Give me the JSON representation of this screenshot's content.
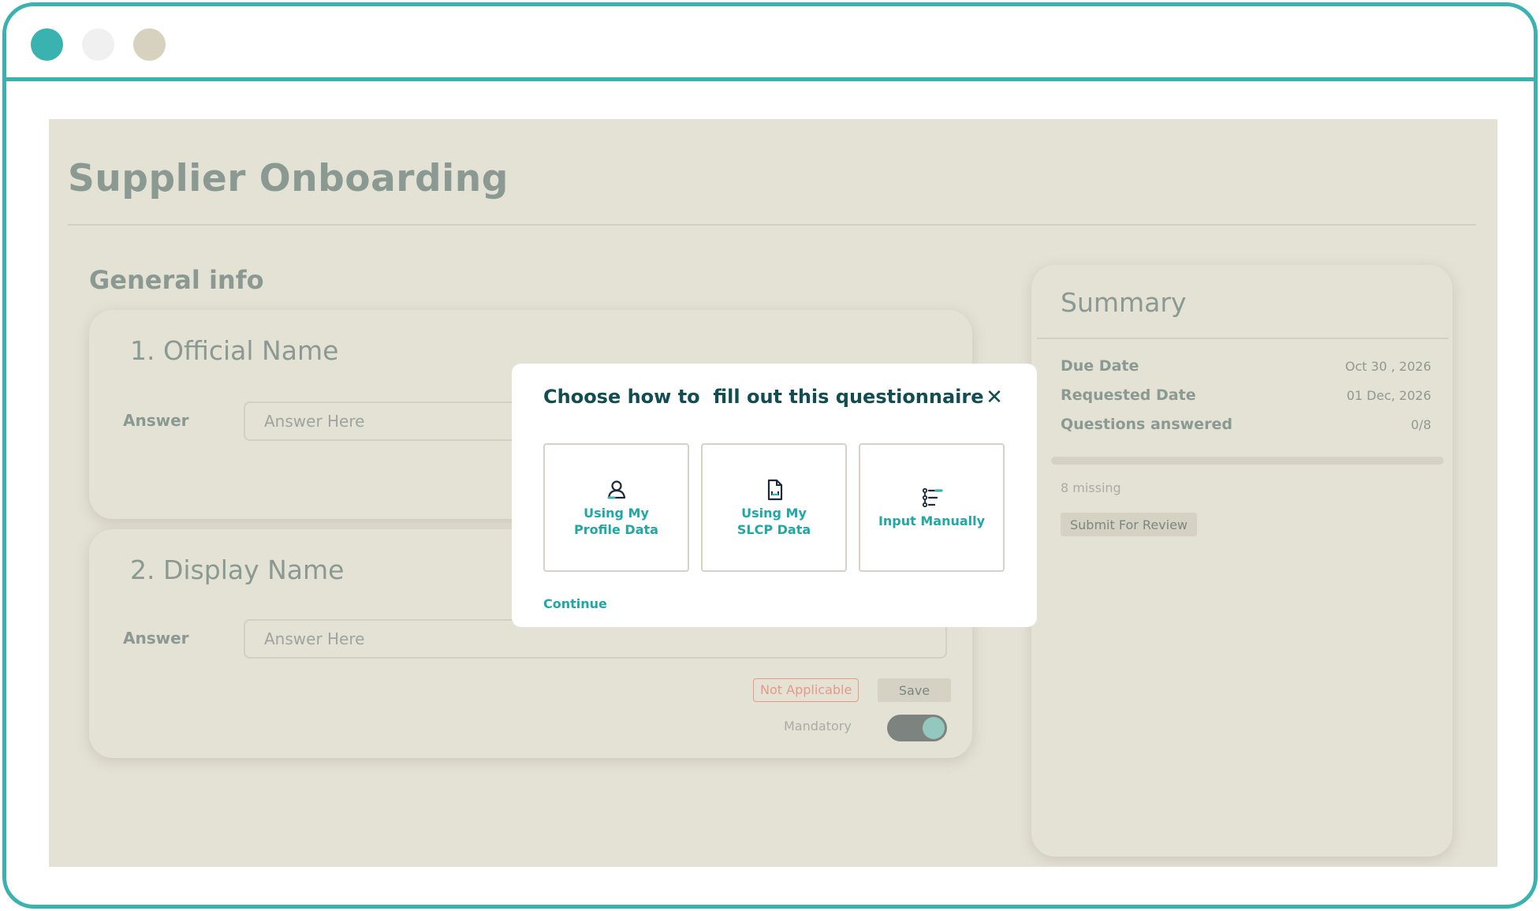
{
  "page": {
    "title": "Supplier Onboarding",
    "section_title": "General info"
  },
  "questions": [
    {
      "title": "1. Official Name",
      "answer_label": "Answer",
      "answer_placeholder": "Answer Here"
    },
    {
      "title": "2. Display Name",
      "answer_label": "Answer",
      "answer_placeholder": "Answer Here",
      "not_applicable_label": "Not Applicable",
      "save_label": "Save",
      "mandatory_label": "Mandatory",
      "mandatory_on": true
    }
  ],
  "summary": {
    "title": "Summary",
    "due_date_label": "Due Date",
    "due_date_value": "Oct 30 , 2026",
    "requested_date_label": "Requested Date",
    "requested_date_value": "01 Dec, 2026",
    "questions_answered_label": "Questions answered",
    "questions_answered_value": "0/8",
    "progress_fraction": 0,
    "missing_text": "8 missing",
    "submit_label": "Submit For Review"
  },
  "modal": {
    "title": "Choose how to  fill out this questionnaire",
    "close_glyph": "✕",
    "options": [
      {
        "label": "Using My\nProfile Data",
        "icon": "user-icon"
      },
      {
        "label": "Using My\nSLCP Data",
        "icon": "document-icon"
      },
      {
        "label": "Input Manually",
        "icon": "list-edit-icon"
      }
    ],
    "continue_label": "Continue"
  },
  "colors": {
    "accent": "#3ab2b0",
    "modal_title": "#124d52",
    "option_text": "#1fa8a6",
    "not_applicable": "#e49a86",
    "overlay_bg": "#e4e1d5"
  }
}
